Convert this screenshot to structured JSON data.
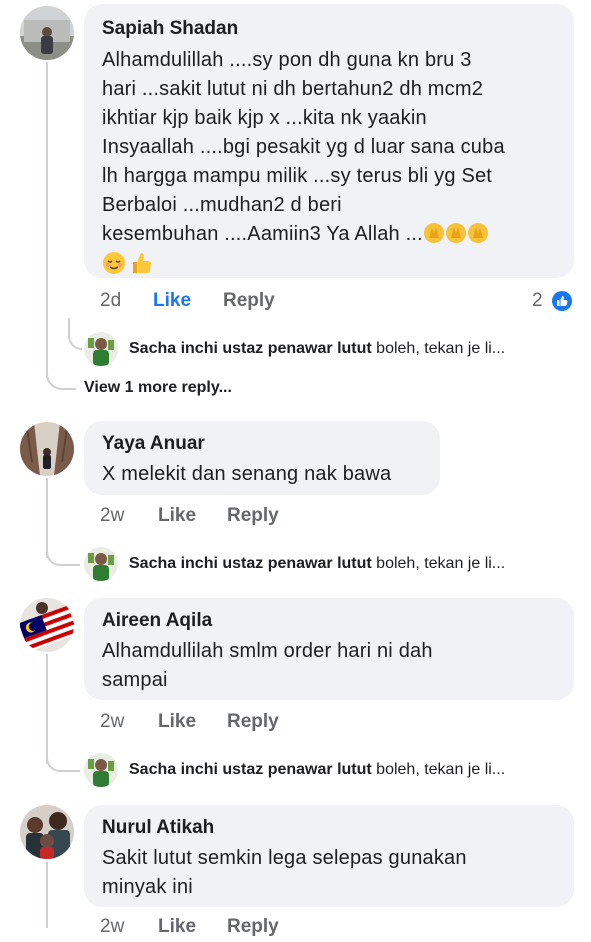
{
  "comments": [
    {
      "author": "Sapiah Shadan",
      "text": "Alhamdulillah ....sy pon dh guna kn bru 3\nhari ...sakit lutut ni dh bertahun2 dh mcm2\nikhtiar kjp baik kjp x ...kita nk yaakin\nInsyaallah ....bgi pesakit yg d luar sana cuba\nlh hargga mampu milik ...sy terus bli yg Set\nBerbaloi ...mudhan2 d beri\nkesembuhan ....Aamiin3 Ya Allah ...",
      "time": "2d",
      "like": "Like",
      "reply": "Reply",
      "reactions": "2",
      "emojis": [
        "folded-hands",
        "folded-hands",
        "folded-hands",
        "relieved-face",
        "thumbs-up"
      ]
    },
    {
      "author": "Yaya Anuar",
      "text": "X melekit dan senang nak bawa",
      "time": "2w",
      "like": "Like",
      "reply": "Reply"
    },
    {
      "author": "Aireen Aqila",
      "text": "Alhamdullilah smlm order hari ni dah\nsampai",
      "time": "2w",
      "like": "Like",
      "reply": "Reply"
    },
    {
      "author": "Nurul Atikah",
      "text": "Sakit lutut semkin lega selepas gunakan\nminyak ini",
      "time": "2w",
      "like": "Like",
      "reply": "Reply"
    }
  ],
  "replies": [
    {
      "author": "Sacha inchi ustaz penawar lutut",
      "snippet": "boleh, tekan je li..."
    },
    {
      "author": "Sacha inchi ustaz penawar lutut",
      "snippet": "boleh, tekan je li..."
    },
    {
      "author": "Sacha inchi ustaz penawar lutut",
      "snippet": "boleh, tekan je li..."
    }
  ],
  "view_more": "View 1 more reply...",
  "colors": {
    "like_active": "#1877f2",
    "bubble": "#f0f2f5",
    "meta": "#65676b"
  }
}
